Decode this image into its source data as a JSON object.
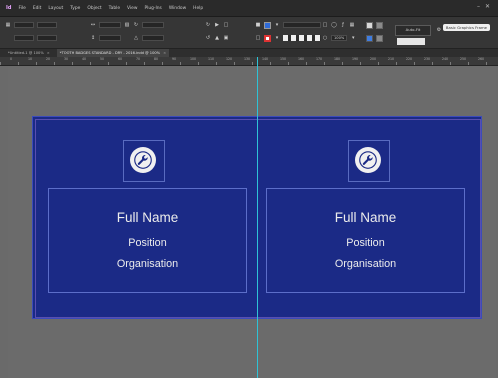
{
  "menubar": {
    "app_mark": "Id",
    "items": [
      "File",
      "Edit",
      "Layout",
      "Type",
      "Object",
      "Table",
      "View",
      "Plug-Ins",
      "Window",
      "Help"
    ]
  },
  "controlbar": {
    "autofit_label": "Auto-Fit",
    "zoom_value": "100%",
    "workspace_label": "Basic Graphics Frame"
  },
  "tabs": [
    {
      "label": "*Untitled-1 @ 100%",
      "active": false
    },
    {
      "label": "*TOOTH BADGES STANDARD - DRY - 2016.indd @ 100%",
      "active": true
    }
  ],
  "ruler_numbers": [
    "0",
    "10",
    "20",
    "30",
    "40",
    "50",
    "60",
    "70",
    "80",
    "90",
    "100",
    "110",
    "120",
    "130",
    "140",
    "150",
    "160",
    "170",
    "180",
    "190",
    "200",
    "210",
    "220",
    "230",
    "240",
    "250",
    "260"
  ],
  "document": {
    "background_color": "#1b2a86",
    "guide_color": "#2ec3d6",
    "cards": [
      {
        "name": "Full Name",
        "position": "Position",
        "organisation": "Organisation",
        "logo": "wrench-icon"
      },
      {
        "name": "Full Name",
        "position": "Position",
        "organisation": "Organisation",
        "logo": "wrench-icon"
      }
    ]
  }
}
